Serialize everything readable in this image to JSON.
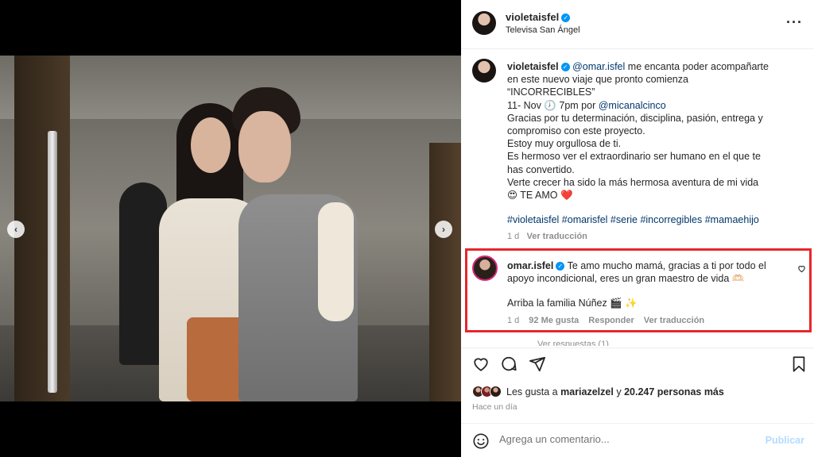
{
  "post": {
    "username": "violetaisfel",
    "location": "Televisa San Ángel",
    "more_icon": "more-horizontal-icon"
  },
  "caption": {
    "mention1": "@omar.isfel",
    "line1_rest": "me encanta poder acompañarte en este nuevo viaje que pronto comienza",
    "line2": "“INCORRECIBLES”",
    "date_pre": "11- Nov",
    "clock_emoji": "🕖",
    "date_post": "7pm por",
    "mention2": "@micanalcinco",
    "line4": "Gracias por tu determinación, disciplina, pasión, entrega y compromiso con este proyecto.",
    "line5": "Estoy muy orgullosa de ti.",
    "line6": "Es hermoso ver el extraordinario ser humano en el que te has convertido.",
    "line7": "Verte crecer ha sido la más hermosa aventura de mi vida 😍 TE AMO ❤️",
    "hashtags": "#violetaisfel #omarisfel #serie #incorregibles #mamaehijo",
    "age": "1 d",
    "translate": "Ver traducción"
  },
  "comment": {
    "username": "omar.isfel",
    "text": "Te amo mucho mamá, gracias a ti por todo el apoyo incondicional, eres un gran maestro de vida 🫶🏻",
    "text2": "Arriba la familia Núñez 🎬 ✨",
    "age": "1 d",
    "likes": "92 Me gusta",
    "reply": "Responder",
    "translate": "Ver traducción",
    "more_replies": "Ver respuestas (1)"
  },
  "actions": {
    "like_icon": "heart-icon",
    "comment_icon": "comment-icon",
    "share_icon": "share-icon",
    "save_icon": "bookmark-icon"
  },
  "likes": {
    "prefix": "Les gusta a",
    "user": "mariazelzel",
    "middle": "y",
    "count": "20.247 personas más"
  },
  "time": "Hace un día",
  "add_comment": {
    "placeholder": "Agrega un comentario...",
    "publish": "Publicar"
  },
  "carousel": {
    "prev": "‹",
    "next": "›",
    "slides": 4,
    "active": 2
  },
  "colors": {
    "highlight_border": "#e8262b",
    "link": "#00376b",
    "verified": "#0095f6"
  }
}
